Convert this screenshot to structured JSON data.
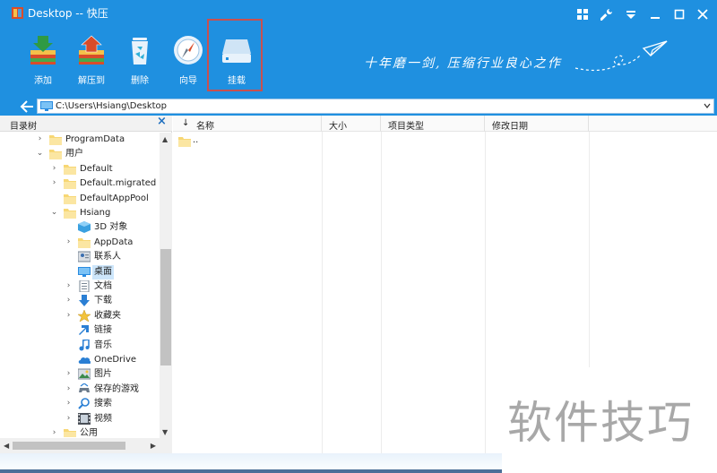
{
  "window": {
    "title": "Desktop -- 快压",
    "accent_color": "#1f90e0"
  },
  "toolbar": {
    "buttons": [
      {
        "label": "添加",
        "icon": "add-archive-icon"
      },
      {
        "label": "解压到",
        "icon": "extract-to-icon"
      },
      {
        "label": "删除",
        "icon": "delete-icon"
      },
      {
        "label": "向导",
        "icon": "wizard-compass-icon"
      },
      {
        "label": "挂载",
        "icon": "mount-drive-icon"
      }
    ],
    "highlighted": "挂载",
    "highlight_color": "#c9504f"
  },
  "slogan": "十年磨一剑, 压缩行业良心之作",
  "address": {
    "path": "C:\\Users\\Hsiang\\Desktop"
  },
  "tree": {
    "title": "目录树",
    "close_glyph": "×",
    "items": [
      {
        "label": "ProgramData",
        "icon": "folder-icon",
        "arrow": "›"
      },
      {
        "label": "用户",
        "icon": "folder-icon",
        "arrow": "⌄"
      },
      {
        "label": "Default",
        "icon": "folder-icon",
        "arrow": "›"
      },
      {
        "label": "Default.migrated",
        "icon": "folder-icon",
        "arrow": "›"
      },
      {
        "label": "DefaultAppPool",
        "icon": "folder-icon",
        "arrow": ""
      },
      {
        "label": "Hsiang",
        "icon": "folder-icon",
        "arrow": "⌄"
      },
      {
        "label": "3D 对象",
        "icon": "3d-objects-icon",
        "arrow": ""
      },
      {
        "label": "AppData",
        "icon": "folder-icon",
        "arrow": "›"
      },
      {
        "label": "联系人",
        "icon": "contacts-icon",
        "arrow": ""
      },
      {
        "label": "桌面",
        "icon": "desktop-icon",
        "arrow": "",
        "selected": true
      },
      {
        "label": "文档",
        "icon": "documents-icon",
        "arrow": "›"
      },
      {
        "label": "下载",
        "icon": "downloads-icon",
        "arrow": "›"
      },
      {
        "label": "收藏夹",
        "icon": "favorites-icon",
        "arrow": "›"
      },
      {
        "label": "链接",
        "icon": "links-icon",
        "arrow": ""
      },
      {
        "label": "音乐",
        "icon": "music-icon",
        "arrow": ""
      },
      {
        "label": "OneDrive",
        "icon": "onedrive-icon",
        "arrow": ""
      },
      {
        "label": "图片",
        "icon": "pictures-icon",
        "arrow": "›"
      },
      {
        "label": "保存的游戏",
        "icon": "saved-games-icon",
        "arrow": "›"
      },
      {
        "label": "搜索",
        "icon": "search-icon",
        "arrow": "›"
      },
      {
        "label": "视频",
        "icon": "videos-icon",
        "arrow": "›"
      },
      {
        "label": "公用",
        "icon": "folder-icon",
        "arrow": "›"
      }
    ]
  },
  "list": {
    "columns": [
      "名称",
      "大小",
      "项目类型",
      "修改日期"
    ],
    "sort_glyph": "↓",
    "rows": [
      {
        "name": ".."
      }
    ]
  },
  "watermark": "软件技巧"
}
